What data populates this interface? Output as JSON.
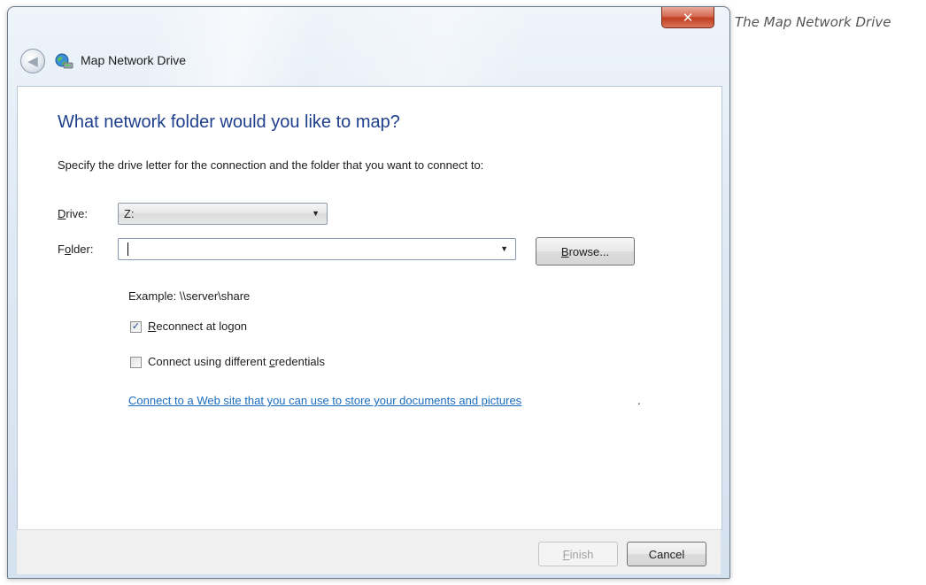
{
  "caption": "The Map Network Drive",
  "window": {
    "title": "Map Network Drive",
    "close_glyph": "✕",
    "back_glyph": "◀",
    "icons": {
      "close": "close-icon",
      "back": "back-arrow-icon",
      "title": "network-drive-icon"
    }
  },
  "content": {
    "heading": "What network folder would you like to map?",
    "instruction": "Specify the drive letter for the connection and the folder that you want to connect to:",
    "drive": {
      "label_mnemonic": "D",
      "label_rest": "rive:",
      "value": "Z:"
    },
    "folder": {
      "label_pre": "F",
      "label_mnemonic": "o",
      "label_rest": "lder:",
      "value": ""
    },
    "browse": {
      "label_mnemonic": "B",
      "label_rest": "rowse..."
    },
    "example": "Example: \\\\server\\share",
    "reconnect": {
      "checked": true,
      "check_glyph": "✓",
      "label_mnemonic": "R",
      "label_rest": "econnect at logon"
    },
    "credentials": {
      "checked": false,
      "label_pre": "Connect using different ",
      "label_mnemonic": "c",
      "label_rest": "redentials"
    },
    "link": "Connect to a Web site that you can use to store your documents and pictures",
    "link_tail": "."
  },
  "footer": {
    "finish": {
      "label_mnemonic": "F",
      "label_rest": "inish",
      "enabled": false
    },
    "cancel": {
      "label": "Cancel"
    }
  },
  "colors": {
    "heading": "#1e3f8c",
    "link": "#1a6cc0",
    "close_button": "#c23d1f"
  }
}
